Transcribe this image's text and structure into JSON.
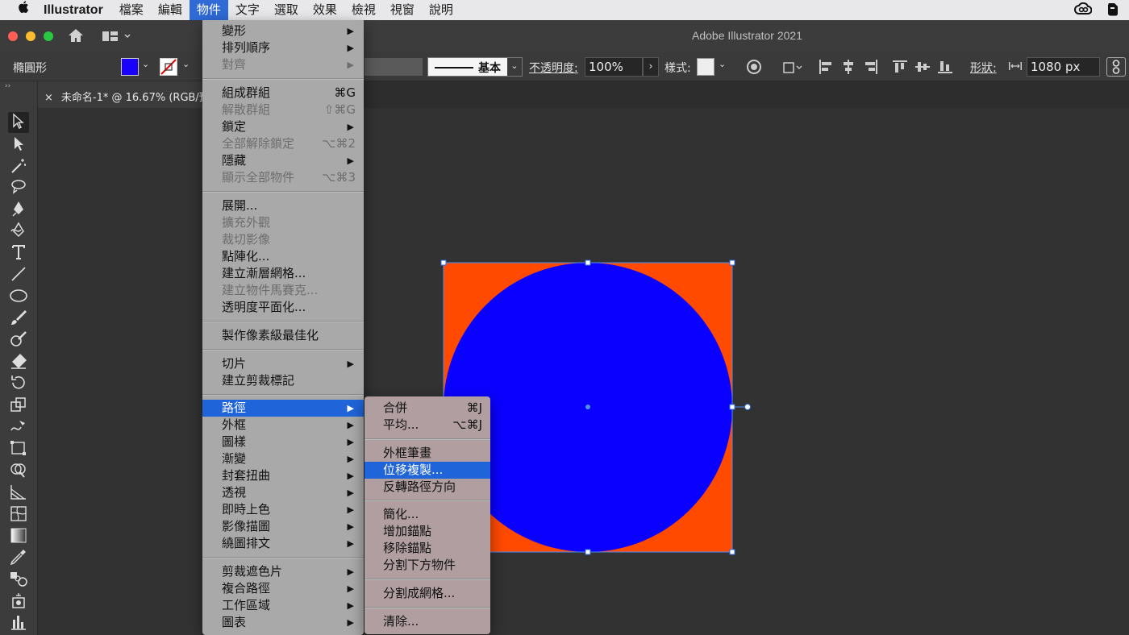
{
  "menubar": {
    "apple": "",
    "app": "Illustrator",
    "items": [
      "檔案",
      "編輯",
      "物件",
      "文字",
      "選取",
      "效果",
      "檢視",
      "視窗",
      "說明"
    ],
    "active_index": 2
  },
  "titlebar": {
    "title": "Adobe Illustrator 2021"
  },
  "controlbar": {
    "shape_label": "橢圓形",
    "fill_color": "#1a00ff",
    "stroke_style": "基本",
    "opacity_label": "不透明度:",
    "opacity_value": "100%",
    "style_label": "樣式:",
    "shape_prop_label": "形狀:",
    "width_value": "1080 px"
  },
  "tab": {
    "close": "×",
    "title": "未命名-1* @ 16.67% (RGB/預視)"
  },
  "object_menu": [
    {
      "label": "變形",
      "arrow": true
    },
    {
      "label": "排列順序",
      "arrow": true
    },
    {
      "label": "對齊",
      "arrow": true,
      "disabled": true
    },
    {
      "label": "組成群組",
      "shortcut": "⌘G"
    },
    {
      "label": "解散群組",
      "shortcut": "⇧⌘G",
      "disabled": true
    },
    {
      "label": "鎖定",
      "arrow": true
    },
    {
      "label": "全部解除鎖定",
      "shortcut": "⌥⌘2",
      "disabled": true
    },
    {
      "label": "隱藏",
      "arrow": true
    },
    {
      "label": "顯示全部物件",
      "shortcut": "⌥⌘3",
      "disabled": true
    },
    {
      "label": "展開..."
    },
    {
      "label": "擴充外觀",
      "disabled": true
    },
    {
      "label": "裁切影像",
      "disabled": true
    },
    {
      "label": "點陣化..."
    },
    {
      "label": "建立漸層網格..."
    },
    {
      "label": "建立物件馬賽克...",
      "disabled": true
    },
    {
      "label": "透明度平面化..."
    },
    {
      "label": "製作像素級最佳化"
    },
    {
      "label": "切片",
      "arrow": true
    },
    {
      "label": "建立剪裁標記"
    },
    {
      "label": "路徑",
      "arrow": true,
      "highlighted": true
    },
    {
      "label": "外框",
      "arrow": true
    },
    {
      "label": "圖樣",
      "arrow": true
    },
    {
      "label": "漸變",
      "arrow": true
    },
    {
      "label": "封套扭曲",
      "arrow": true
    },
    {
      "label": "透視",
      "arrow": true
    },
    {
      "label": "即時上色",
      "arrow": true
    },
    {
      "label": "影像描圖",
      "arrow": true
    },
    {
      "label": "繞圖排文",
      "arrow": true
    },
    {
      "label": "剪裁遮色片",
      "arrow": true
    },
    {
      "label": "複合路徑",
      "arrow": true
    },
    {
      "label": "工作區域",
      "arrow": true
    },
    {
      "label": "圖表",
      "arrow": true
    }
  ],
  "path_submenu": [
    {
      "label": "合併",
      "shortcut": "⌘J"
    },
    {
      "label": "平均...",
      "shortcut": "⌥⌘J"
    },
    {
      "label": "外框筆畫"
    },
    {
      "label": "位移複製...",
      "highlighted": true
    },
    {
      "label": "反轉路徑方向"
    },
    {
      "label": "簡化..."
    },
    {
      "label": "增加錨點"
    },
    {
      "label": "移除錨點"
    },
    {
      "label": "分割下方物件"
    },
    {
      "label": "分割成網格..."
    },
    {
      "label": "清除..."
    }
  ],
  "artwork": {
    "square_color": "#ff4a00",
    "circle_color": "#0a00ff"
  }
}
